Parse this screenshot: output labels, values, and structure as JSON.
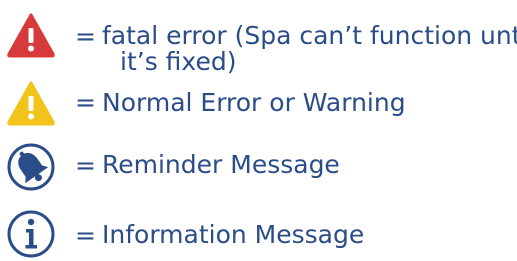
{
  "legend": {
    "items": [
      {
        "icon": "fatal-error-icon",
        "icon_color": "#d63a3a",
        "equals": "=",
        "label_line1": "fatal error (Spa can’t function until",
        "label_line2": "it’s fixed)"
      },
      {
        "icon": "warning-icon",
        "icon_color": "#f2c31b",
        "equals": "=",
        "label_line1": "Normal Error or Warning"
      },
      {
        "icon": "bell-icon",
        "icon_color": "#2a4c88",
        "equals": "=",
        "label_line1": "Reminder Message"
      },
      {
        "icon": "info-icon",
        "icon_color": "#2a4c88",
        "equals": "=",
        "label_line1": "Information Message"
      }
    ]
  },
  "colors": {
    "text": "#2a4c88",
    "fatal": "#d63a3a",
    "warning": "#f2c31b",
    "blue": "#2a4c88"
  }
}
